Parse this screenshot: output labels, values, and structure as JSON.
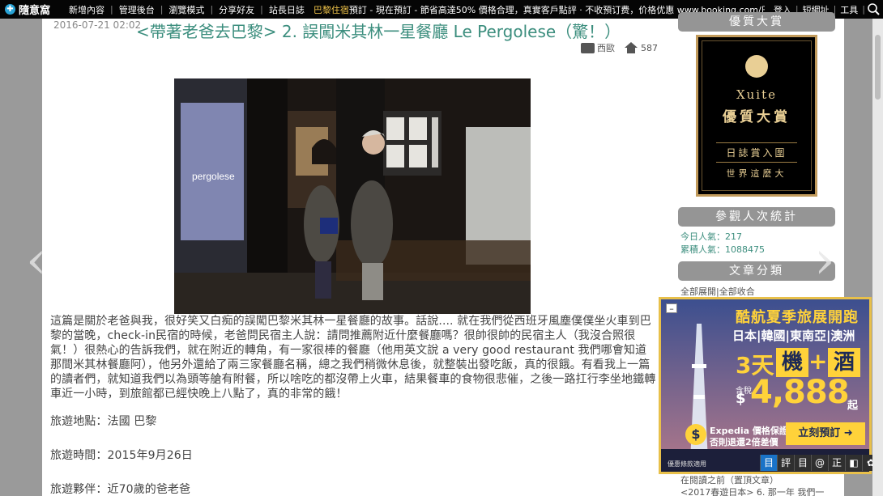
{
  "topbar": {
    "logo_text": "隨意窩",
    "nav": [
      "新增內容",
      "管理後台",
      "瀏覽模式",
      "分享好友",
      "站長日誌"
    ],
    "ticker_highlight": "巴黎住宿",
    "ticker_text": "預訂 - 現在預訂 - 節省高達50% 價格合理，真實客戶點評 · 不收預订费，价格优惠 www.booking.com/巴",
    "right_links": [
      "登入",
      "短網址",
      "工具"
    ]
  },
  "post": {
    "date": "2016-07-21 02:02",
    "title": "<帶著老爸去巴黎> 2. 誤闖米其林一星餐廳 Le Pergolese（驚！）",
    "category": "西歐",
    "views": "587",
    "photo_sign": "pergolese",
    "paragraph": "這篇是關於老爸與我，很好笑又白痴的誤闖巴黎米其林一星餐廳的故事。話說.... 就在我們從西班牙風塵僕僕坐火車到巴黎的當晚，check-in民宿的時候，老爸問民宿主人說：請問推薦附近什麼餐廳嗎？很帥很帥的民宿主人（我沒合照很氣！）很熱心的告訴我們，就在附近的轉角，有一家很棒的餐廳（他用英文說 a very good restaurant 我們哪會知道那間米其林餐廳阿），他另外還給了兩三家餐廳名稱，總之我們稍微休息後，就整裝出發吃飯，真的很餓。有看我上一篇的讀者們，就知道我們以為頭等艙有附餐，所以啥吃的都沒帶上火車，結果餐車的食物很悲催，之後一路扛行李坐地鐵轉車近一小時，到旅館都已經快晚上八點了，真的非常的餓！",
    "place": "旅遊地點：法國 巴黎",
    "time": "旅遊時間：2015年9月26日",
    "companion": "旅遊夥伴：近70歲的爸老爸"
  },
  "sidebar": {
    "ribbon_award": "優質大賞",
    "award": {
      "brand": "Xuite",
      "title": "優質大賞",
      "badge": "日誌賞入圍",
      "tagline": "世界這麼大"
    },
    "ribbon_stats": "參觀人次統計",
    "stats": {
      "today": "今日人氣：217",
      "total": "累積人氣：1088475"
    },
    "ribbon_category": "文章分類",
    "expand_all": "全部展開",
    "collapse_all": "全部收合",
    "prev_label": "在閱讀之前（置頂文章）",
    "prev_link": "<2017春遊日本> 6. 那一年 我們一"
  },
  "ad": {
    "headline": "酷航夏季旅展開跑",
    "countries": "日本|韓國|東南亞|澳洲",
    "days": "3天",
    "box1": "機",
    "plus": "+",
    "box2": "酒",
    "tax": "含稅",
    "dollar": "$",
    "price": "4,888",
    "qi": "起",
    "expedia1": "Expedia 價格保證",
    "expedia2": "否則退還2倍差價",
    "cta": "立刻預訂 ➜",
    "fine": "優惠條款適用",
    "close": "–"
  },
  "tools": [
    "目",
    "評",
    "目",
    "@",
    "正",
    "◧",
    "✿"
  ],
  "colors": {
    "title": "#3c8e7e",
    "ticker_highlight": "#f3c64a",
    "ribbon": "#959595",
    "ad_gold": "#ffd23a"
  }
}
